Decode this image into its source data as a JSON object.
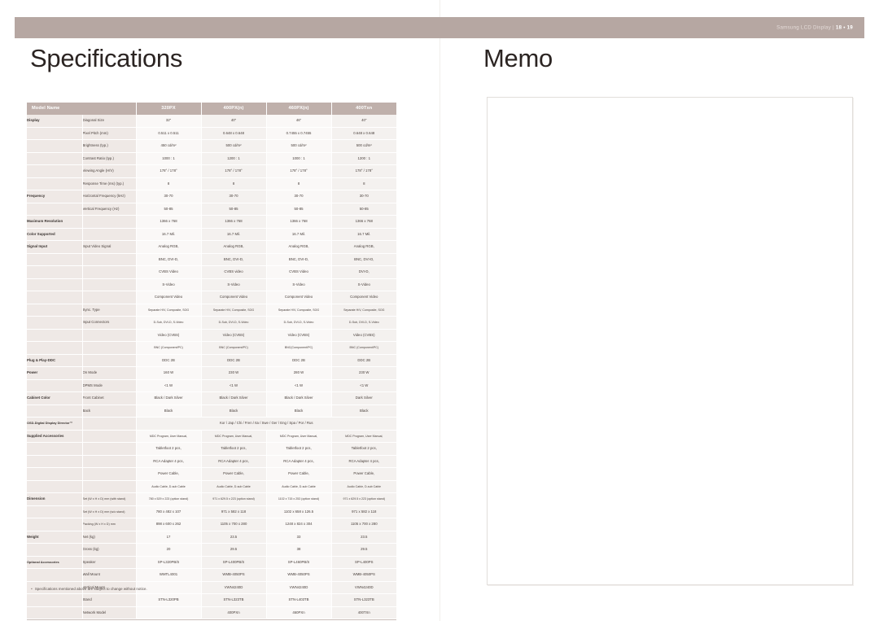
{
  "header": {
    "folio_prefix": "Samsung LCD Display | ",
    "folio_pages": "18 • 19"
  },
  "left_page": {
    "title": "Specifications",
    "footnote_bullet": "▪",
    "footnote": "Specifications mentioned above are subject to change without notice."
  },
  "right_page": {
    "title": "Memo"
  },
  "colors": {
    "band": "#b6a7a2",
    "table_header": "#bfb0ab",
    "group_cell": "#efe9e6",
    "value_cell": "#faf8f7",
    "text": "#4a403c"
  },
  "table": {
    "header": {
      "name_label": "Model Name",
      "models": [
        "320PX",
        "400PX(n)",
        "460PX(n)",
        "400Txn"
      ]
    },
    "rows": [
      {
        "group": "Display",
        "sub": "Diagonal Size",
        "values": [
          "32\"",
          "40\"",
          "46\"",
          "40\""
        ]
      },
      {
        "group": "",
        "sub": "Pixel Pitch (mm)",
        "values": [
          "0.511 x 0.511",
          "0.648 x 0.648",
          "0.7455 x 0.7455",
          "0.648 x 0.648"
        ]
      },
      {
        "group": "",
        "sub": "Brightness (typ.)",
        "values": [
          "450 cd/m²",
          "500 cd/m²",
          "500 cd/m²",
          "500 cd/m²"
        ]
      },
      {
        "group": "",
        "sub": "Contrast Ratio (typ.)",
        "values": [
          "1000 : 1",
          "1200 : 1",
          "1000 : 1",
          "1200 : 1"
        ]
      },
      {
        "group": "",
        "sub": "Viewing Angle (H/V)",
        "values": [
          "178° / 178°",
          "178° / 178°",
          "178° / 178°",
          "178° / 178°"
        ]
      },
      {
        "group": "",
        "sub": "Response Time (ms) (typ.)",
        "values": [
          "8",
          "8",
          "8",
          "8"
        ]
      },
      {
        "group": "Frequency",
        "sub": "Horizontal Frequency (kHz)",
        "values": [
          "30-70",
          "30-70",
          "30-70",
          "30-70"
        ]
      },
      {
        "group": "",
        "sub": "Vertical Frequency (Hz)",
        "values": [
          "50-85",
          "50-85",
          "50-85",
          "50-85"
        ]
      },
      {
        "group": "Maximum Resolution",
        "sub": "",
        "values": [
          "1366 x 768",
          "1366 x 768",
          "1366 x 768",
          "1366 x 768"
        ]
      },
      {
        "group": "Color Supported",
        "sub": "",
        "values": [
          "16.7 Mil.",
          "16.7 Mil.",
          "16.7 Mil.",
          "16.7 Mil."
        ]
      },
      {
        "group": "Signal  Input",
        "sub": "Input Video Signal",
        "values": [
          "Analog RGB,",
          "Analog RGB,",
          "Analog RGB,",
          "Analog RGB,"
        ]
      },
      {
        "group": "",
        "sub": "",
        "values": [
          "BNC, DVI-D,",
          "BNC, DVI-D,",
          "BNC, DVI-D,",
          "BNC, DVI-D,"
        ]
      },
      {
        "group": "",
        "sub": "",
        "values": [
          "CVBS Video",
          "CVBS video",
          "CVBS Video",
          "DVI-D,"
        ]
      },
      {
        "group": "",
        "sub": "",
        "values": [
          "S-Video",
          "S-Video",
          "S-Video",
          "S-Video"
        ]
      },
      {
        "group": "",
        "sub": "",
        "values": [
          "Component Video",
          "Component Video",
          "Component Video",
          "Component Video"
        ]
      },
      {
        "group": "",
        "sub": "Sync. Type",
        "values": [
          "Separate H/V, Composite, SOG",
          "Separate H/V, Composite, SOG",
          "Separate H/V, Composite, SOG",
          "Separate H/V, Composite, SOG"
        ],
        "tiny": true
      },
      {
        "group": "",
        "sub": "Input Connectors",
        "values": [
          "D-Sub, DVI-D, S-Video",
          "D-Sub, DVI-D, S-Video",
          "D-Sub, DVI-D, S-Video",
          "D-Sub, DVI-D, S-Video"
        ],
        "tiny": true
      },
      {
        "group": "",
        "sub": "",
        "values": [
          "Video (CVBS)",
          "Video (CVBS)",
          "Video (CVBS)",
          "Video (CVBS)"
        ]
      },
      {
        "group": "",
        "sub": "",
        "values": [
          "BNC (Component/PC)",
          "BNC (Component/PC)",
          "BNC(Component/PC)",
          "BNC (Component/PC)"
        ],
        "tiny": true
      },
      {
        "group": "Plug & Play-DDC",
        "sub": "",
        "values": [
          "DDC 2B",
          "DDC 2B",
          "DDC 2B",
          "DDC 2B"
        ]
      },
      {
        "group": "Power",
        "sub": "On Mode",
        "values": [
          "160 W",
          "230 W",
          "280 W",
          "230 W"
        ]
      },
      {
        "group": "",
        "sub": "DPMS Mode",
        "values": [
          "<1 W",
          "<1 W",
          "<1 W",
          "<1 W"
        ]
      },
      {
        "group": "Cabinet Color",
        "sub": "Front Cabinet",
        "values": [
          "Black / Dark Silver",
          "Black / Dark Silver",
          "Black / Dark Silver",
          "Dark Silver"
        ]
      },
      {
        "group": "",
        "sub": "Back",
        "values": [
          "Black",
          "Black",
          "Black",
          "Black"
        ]
      },
      {
        "group": "OSD-Digital Display Director™",
        "sub": "",
        "span": "Kor / Jap / Chi / Fren / Ita / Swe / Ger / Eng / Spa / Por / Rus",
        "groupsmall": true
      },
      {
        "group": "Supplied Accessories",
        "sub": "",
        "values": [
          "MDC Program, User Manual,",
          "MDC Program, User Manual,",
          "MDC Program, User Manual,",
          "MDC Program, User Manual,"
        ],
        "tiny": true
      },
      {
        "group": "",
        "sub": "",
        "values": [
          "Tabletfoot 2 pcs,",
          "Tabletfoot 2 pcs,",
          "Tabletfoot 2 pcs,",
          "Tabletfoot 2 pcs,"
        ]
      },
      {
        "group": "",
        "sub": "",
        "values": [
          "RCA Adapter 4 pcs,",
          "RCA Adapter 4 pcs,",
          "RCA Adapter 4 pcs,",
          "RCA Adapter 4 pcs,"
        ]
      },
      {
        "group": "",
        "sub": "",
        "values": [
          "Power Cable,",
          "Power Cable,",
          "Power Cable,",
          "Power Cable,"
        ]
      },
      {
        "group": "",
        "sub": "",
        "values": [
          "Audio Cable, D-sub Cable",
          "Audio Cable, D-sub Cable",
          "Audio Cable, D-sub Cable",
          "Audio Cable, D-sub Cable"
        ],
        "tiny": true
      },
      {
        "group": "Dimension",
        "sub": "Set (W x H x D) mm (with stand)",
        "values": [
          "780 x 529 x 223 (option stand)",
          "971 x 629.5 x 223 (option stand)",
          "1102 x 715 x 253 (option stand)",
          "971 x 629.5 x 223 (option stand)"
        ],
        "tiny": true,
        "subtiny": true
      },
      {
        "group": "",
        "sub": "Set (W x H x D) mm (w/o stand)",
        "values": [
          "780 x 482 x 107",
          "971 x 582 x 118",
          "1102 x 658 x 126.5",
          "971 x 582 x 118"
        ],
        "subtiny": true
      },
      {
        "group": "",
        "sub": "Packing (W x H x D) mm",
        "values": [
          "898 x 600 x 262",
          "1105 x 700 x 280",
          "1248 x 824 x 304",
          "1105 x 700 x 280"
        ],
        "subtiny": true
      },
      {
        "group": "Weight",
        "sub": "Net (kg)",
        "values": [
          "17",
          "23.5",
          "33",
          "23.5"
        ]
      },
      {
        "group": "",
        "sub": "Gross (kg)",
        "values": [
          "20",
          "29.5",
          "38",
          "29.5"
        ]
      },
      {
        "group": "Optional Accessories",
        "sub": "Speaker",
        "values": [
          "SP-L320PB/S",
          "SP-L400PB/S",
          "SP-L460PB/S",
          "SP-L400PS"
        ],
        "groupsmall": true
      },
      {
        "group": "",
        "sub": "Wall Mount",
        "values": [
          "WMTL4001",
          "WMB-4050PS",
          "WMB-4050PS",
          "WMB-4050PS"
        ]
      },
      {
        "group": "",
        "sub": "Vertical Mount",
        "values": [
          "",
          "VWN4240D",
          "VWN4240D",
          "VWN4240D"
        ]
      },
      {
        "group": "",
        "sub": "Stand",
        "values": [
          "STN-L320PB",
          "STN-L323TB",
          "STN-L403TB",
          "STN-L323TB"
        ]
      },
      {
        "group": "",
        "sub": "Network Model",
        "values": [
          "",
          "400PXn",
          "460PXn",
          "400TXn"
        ]
      }
    ]
  }
}
